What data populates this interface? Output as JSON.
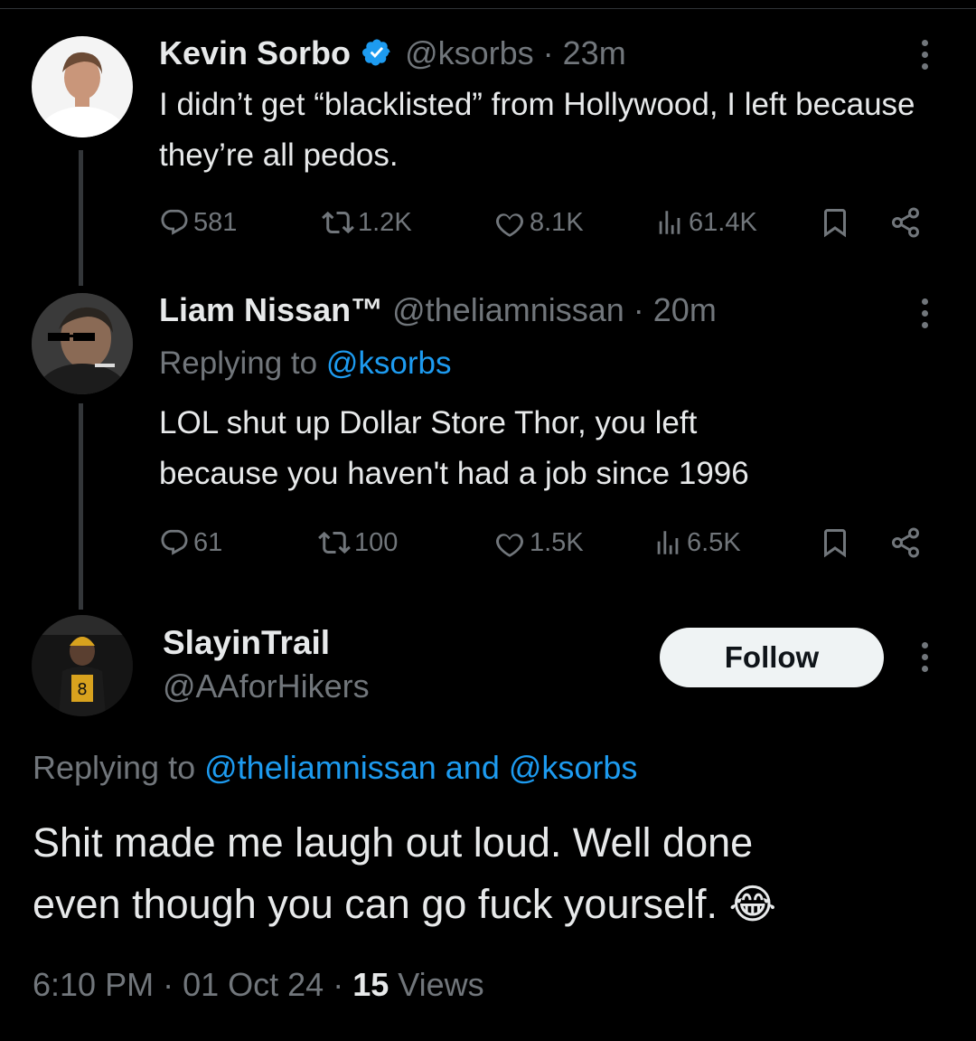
{
  "tweets": [
    {
      "display_name": "Kevin Sorbo",
      "handle": "@ksorbs",
      "time": "· 23m",
      "text": "I didn’t get “blacklisted” from Hollywood, I left because they’re all pedos.",
      "replies": "581",
      "reposts": "1.2K",
      "likes": "8.1K",
      "views": "61.4K"
    },
    {
      "display_name": "Liam Nissan™",
      "handle": "@theliamnissan",
      "time": "· 20m",
      "replying_prefix": "Replying to",
      "replying_to": "@ksorbs",
      "text_line1": "LOL shut up Dollar Store Thor, you left",
      "text_line2": "because you haven't had a job since 1996",
      "replies": "61",
      "reposts": "100",
      "likes": "1.5K",
      "views": "6.5K"
    }
  ],
  "main_post": {
    "display_name": "SlayinTrail",
    "handle": "@AAforHikers",
    "follow_label": "Follow",
    "replying_prefix": "Replying to",
    "replying_to": "@theliamnissan and @ksorbs",
    "text_line1": "Shit made me laugh out loud. Well done",
    "text_line2": "even though you can go fuck yourself.",
    "emoji": "😂",
    "time": "6:10 PM",
    "date": "01 Oct 24",
    "views_count": "15",
    "views_label": "Views",
    "separator": "·"
  },
  "colors": {
    "background": "#000000",
    "text": "#e7e9ea",
    "secondary": "#71767b",
    "link": "#1d9bf0",
    "verified": "#1d9bf0"
  },
  "icons": [
    "reply-icon",
    "repost-icon",
    "like-icon",
    "views-icon",
    "bookmark-icon",
    "share-icon",
    "more-icon",
    "verified-badge-icon"
  ]
}
